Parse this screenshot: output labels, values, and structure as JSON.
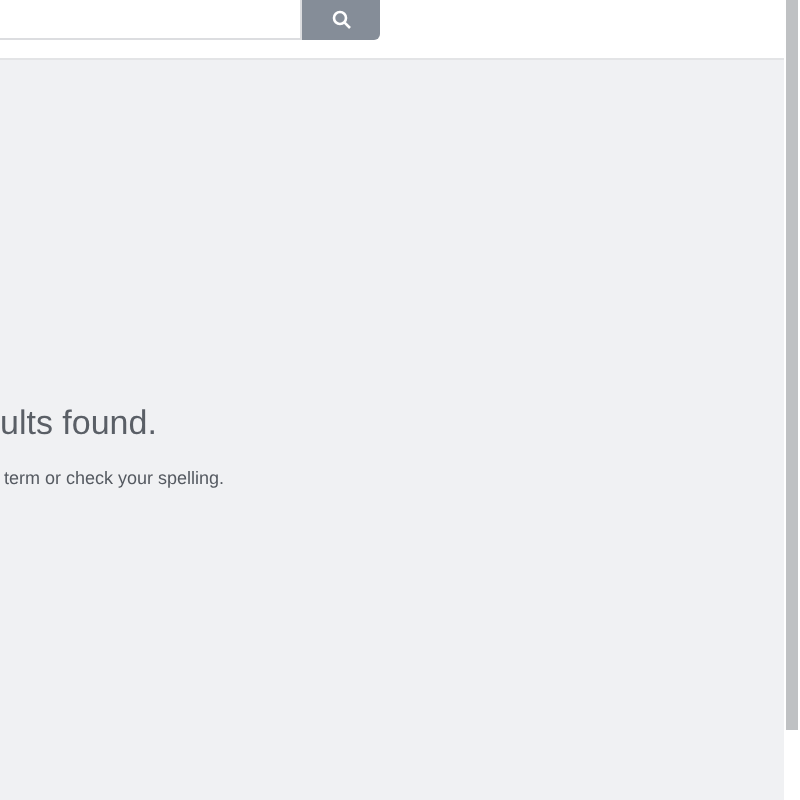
{
  "message": {
    "title": "ults found.",
    "hint": "term or check your spelling."
  }
}
